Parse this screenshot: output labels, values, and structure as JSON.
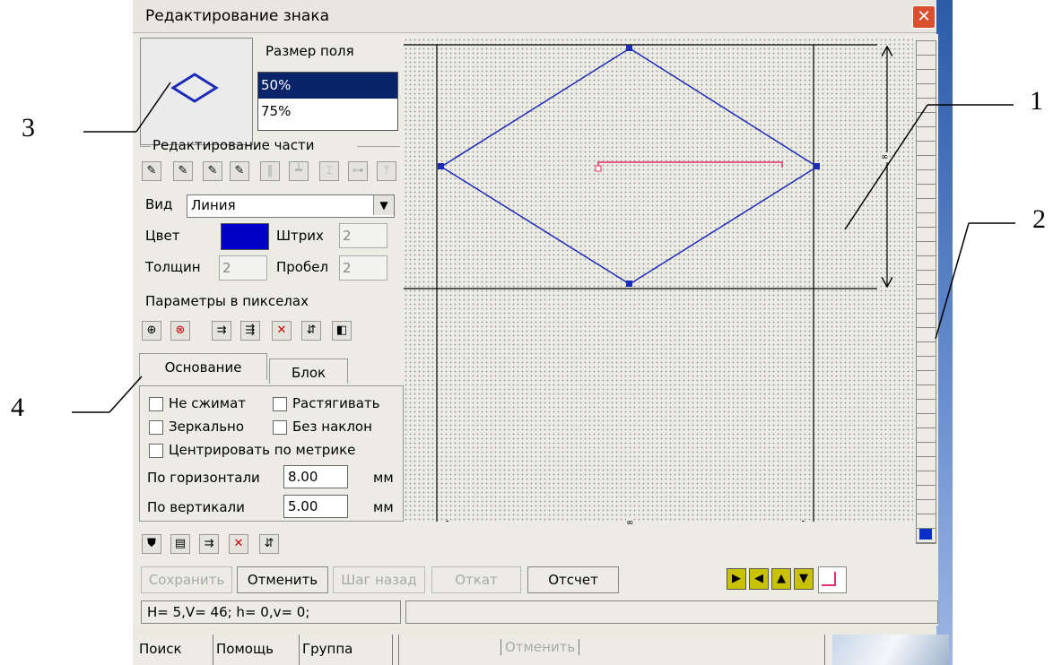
{
  "window": {
    "title": "Редактирование знака",
    "close_glyph": "✕"
  },
  "field_size": {
    "label": "Размер поля",
    "options": [
      "50%",
      "75%"
    ],
    "selected": "50%"
  },
  "part_edit": {
    "group_label": "Редактирование части"
  },
  "view": {
    "label": "Вид",
    "value": "Линия"
  },
  "color": {
    "label": "Цвет",
    "value": "#0000c8"
  },
  "stroke": {
    "label": "Штрих",
    "value": "2"
  },
  "thickness": {
    "label": "Толщин",
    "value": "2"
  },
  "gap": {
    "label": "Пробел",
    "value": "2"
  },
  "params_label": "Параметры в пикселах",
  "tabs": [
    {
      "label": "Основание",
      "active": true
    },
    {
      "label": "Блок",
      "active": false
    }
  ],
  "options": {
    "no_compress": "Не сжимат",
    "stretch": "Растягивать",
    "mirror": "Зеркально",
    "no_tilt": "Без наклон",
    "center_metric": "Центрировать по метрике"
  },
  "horizontal": {
    "label": "По горизонтали",
    "value": "8.00",
    "unit": "мм"
  },
  "vertical": {
    "label": "По вертикали",
    "value": "5.00",
    "unit": "мм"
  },
  "buttons": {
    "save": "Сохранить",
    "cancel": "Отменить",
    "step_back": "Шаг назад",
    "rollback": "Откат",
    "report": "Отсчет"
  },
  "status_text": "H=  5,V= 46; h=  0,v=  0;",
  "taskbar": {
    "search": "Поиск",
    "help": "Помощь",
    "group": "Группа",
    "cancel": "Отменить"
  },
  "canvas": {
    "dim_label_h": "∞",
    "dim_label_v": "∞"
  },
  "callouts": [
    "1",
    "2",
    "3",
    "4"
  ],
  "colors": {
    "shape": "#1c2bb8",
    "red_line": "#e8306a",
    "selected": "#0a246a"
  }
}
